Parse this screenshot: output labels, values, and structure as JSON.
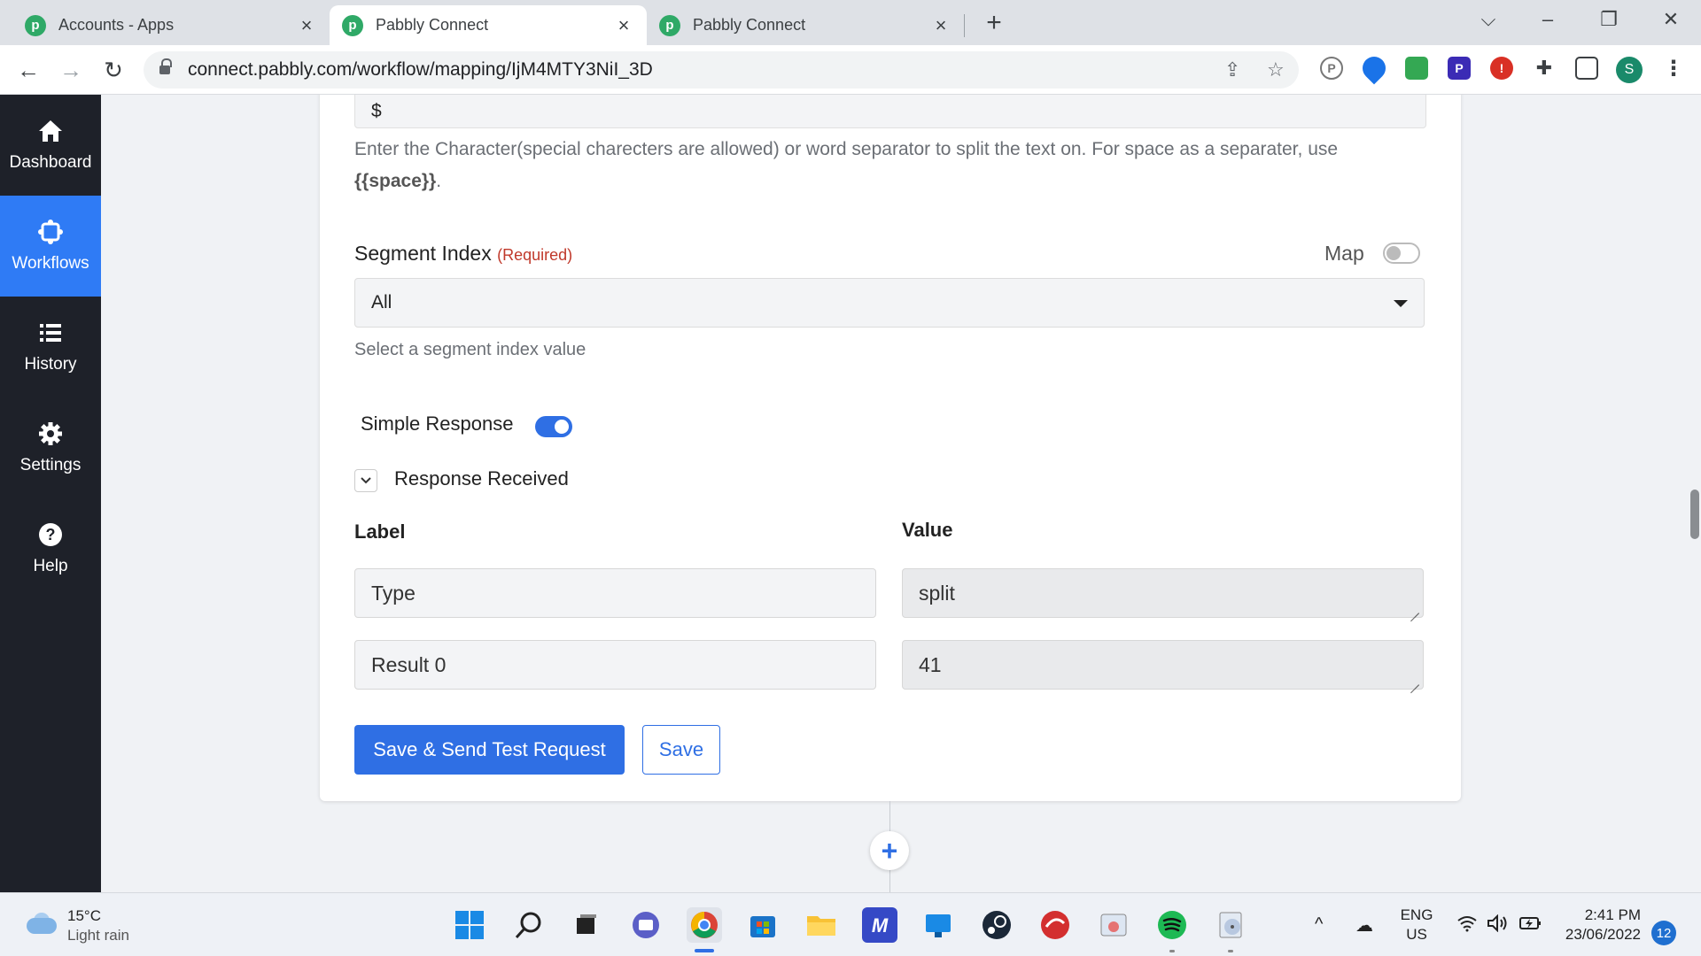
{
  "browser": {
    "tabs": [
      {
        "title": "Accounts - Apps",
        "active": false
      },
      {
        "title": "Pabbly Connect",
        "active": true
      },
      {
        "title": "Pabbly Connect",
        "active": false
      }
    ],
    "url": "connect.pabbly.com/workflow/mapping/IjM4MTY3NiI_3D",
    "profile_initial": "S"
  },
  "sidebar": {
    "items": [
      {
        "label": "Dashboard",
        "icon": "home-icon"
      },
      {
        "label": "Workflows",
        "icon": "workflow-icon",
        "active": true
      },
      {
        "label": "History",
        "icon": "list-icon"
      },
      {
        "label": "Settings",
        "icon": "gear-icon"
      },
      {
        "label": "Help",
        "icon": "help-icon"
      }
    ]
  },
  "form": {
    "separator_value": "$",
    "separator_help_prefix": "Enter the Character(special charecters are allowed) or word separator to split the text on. For space as a separater, use ",
    "separator_help_token": "{{space}}",
    "separator_help_suffix": ".",
    "segment_index_label": "Segment Index",
    "required_label": "(Required)",
    "map_label": "Map",
    "map_enabled": false,
    "segment_index_value": "All",
    "segment_index_hint": "Select a segment index value",
    "simple_response_label": "Simple Response",
    "simple_response_enabled": true,
    "response_received_label": "Response Received",
    "label_header": "Label",
    "value_header": "Value",
    "response_rows": [
      {
        "label": "Type",
        "value": "split"
      },
      {
        "label": "Result 0",
        "value": "41"
      }
    ],
    "save_send_label": "Save & Send Test Request",
    "save_label": "Save"
  },
  "taskbar": {
    "weather_temp": "15°C",
    "weather_desc": "Light rain",
    "language": "ENG",
    "region": "US",
    "time": "2:41 PM",
    "date": "23/06/2022",
    "notification_count": "12"
  },
  "colors": {
    "accent": "#2f6fe4",
    "sidebar_bg": "#1e2129",
    "sidebar_active": "#2f7bf5",
    "required": "#c0392b"
  }
}
